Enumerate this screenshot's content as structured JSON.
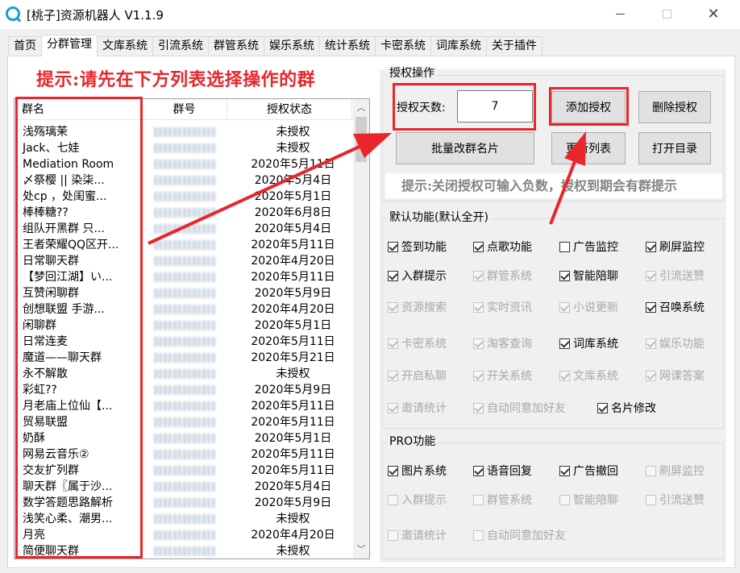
{
  "window": {
    "title": "[桃子]资源机器人 V1.1.9",
    "minimize_label": "—",
    "close_label": "✕"
  },
  "tabs": [
    "首页",
    "分群管理",
    "文库系统",
    "引流系统",
    "群管系统",
    "娱乐系统",
    "统计系统",
    "卡密系统",
    "词库系统",
    "关于插件"
  ],
  "active_tab": "分群管理",
  "notice_top": "提示:请先在下方列表选择操作的群",
  "table": {
    "headers": [
      "群名",
      "群号",
      "授权状态"
    ],
    "rows": [
      {
        "name": "浅殇璃茉",
        "status": "未授权"
      },
      {
        "name": "Jack、七娃",
        "status": "未授权"
      },
      {
        "name": "Mediation Room",
        "status": "2020年5月11日"
      },
      {
        "name": "〆祭樱 || 染柒...",
        "status": "2020年5月4日"
      },
      {
        "name": "处cp ，处闺蜜...",
        "status": "2020年5月1日"
      },
      {
        "name": "棒棒糖??",
        "status": "2020年6月8日"
      },
      {
        "name": "组队开黑群 只...",
        "status": "2020年5月4日"
      },
      {
        "name": "王者荣耀QQ区开...",
        "status": "2020年5月11日"
      },
      {
        "name": "日常聊天群",
        "status": "2020年4月20日"
      },
      {
        "name": "【梦回江湖】い...",
        "status": "2020年5月11日"
      },
      {
        "name": "互赞闲聊群",
        "status": "2020年5月9日"
      },
      {
        "name": "创想联盟 手游...",
        "status": "2020年4月20日"
      },
      {
        "name": "闲聊群",
        "status": "2020年5月1日"
      },
      {
        "name": "日常连麦",
        "status": "2020年5月11日"
      },
      {
        "name": "魔道——聊天群",
        "status": "2020年5月21日"
      },
      {
        "name": "永不解散",
        "status": "未授权"
      },
      {
        "name": "彩虹??",
        "status": "2020年5月9日"
      },
      {
        "name": "月老庙上位仙【...",
        "status": "2020年5月11日"
      },
      {
        "name": "贸易联盟",
        "status": "2020年5月11日"
      },
      {
        "name": "奶酥",
        "status": "2020年5月1日"
      },
      {
        "name": "网易云音乐②",
        "status": "2020年5月11日"
      },
      {
        "name": "交友扩列群",
        "status": "2020年5月11日"
      },
      {
        "name": "聊天群〖属于沙...",
        "status": "2020年5月4日"
      },
      {
        "name": "数学答题思路解析",
        "status": "2020年5月9日"
      },
      {
        "name": "浅笑心柔、潮男...",
        "status": "未授权"
      },
      {
        "name": "月亮",
        "status": "2020年4月20日"
      },
      {
        "name": "简便聊天群",
        "status": "未授权"
      }
    ]
  },
  "auth": {
    "legend": "授权操作",
    "days_label": "授权天数:",
    "days_value": "7",
    "add_button": "添加授权",
    "delete_button": "删除授权",
    "batch_rename_button": "批量改群名片",
    "refresh_button": "更新列表",
    "open_dir_button": "打开目录"
  },
  "notice_mid": "提示:关闭授权可输入负数，授权到期会有群提示",
  "default_features": {
    "legend": "默认功能(默认全开)",
    "items": [
      {
        "label": "签到功能",
        "checked": true,
        "enabled": true
      },
      {
        "label": "点歌功能",
        "checked": true,
        "enabled": true
      },
      {
        "label": "广告监控",
        "checked": false,
        "enabled": true
      },
      {
        "label": "刷屏监控",
        "checked": true,
        "enabled": true
      },
      {
        "label": "入群提示",
        "checked": true,
        "enabled": true
      },
      {
        "label": "群管系统",
        "checked": true,
        "enabled": false
      },
      {
        "label": "智能陪聊",
        "checked": true,
        "enabled": true
      },
      {
        "label": "引流送赞",
        "checked": true,
        "enabled": false
      },
      {
        "label": "资源搜索",
        "checked": true,
        "enabled": false
      },
      {
        "label": "实时资讯",
        "checked": true,
        "enabled": false
      },
      {
        "label": "小说更新",
        "checked": true,
        "enabled": false
      },
      {
        "label": "召唤系统",
        "checked": true,
        "enabled": true
      },
      {
        "label": "卡密系统",
        "checked": true,
        "enabled": false
      },
      {
        "label": "淘客查询",
        "checked": true,
        "enabled": false
      },
      {
        "label": "词库系统",
        "checked": true,
        "enabled": true
      },
      {
        "label": "娱乐功能",
        "checked": true,
        "enabled": false
      },
      {
        "label": "开启私聊",
        "checked": true,
        "enabled": false
      },
      {
        "label": "开关系统",
        "checked": true,
        "enabled": false
      },
      {
        "label": "文库系统",
        "checked": true,
        "enabled": false
      },
      {
        "label": "网课答案",
        "checked": true,
        "enabled": false
      },
      {
        "label": "邀请统计",
        "checked": true,
        "enabled": false
      },
      {
        "label": "自动同意加好友",
        "checked": true,
        "enabled": false
      },
      {
        "label": "名片修改",
        "checked": true,
        "enabled": true
      }
    ]
  },
  "pro_features": {
    "legend": "PRO功能",
    "items": [
      {
        "label": "图片系统",
        "checked": true,
        "enabled": true
      },
      {
        "label": "语音回复",
        "checked": true,
        "enabled": true
      },
      {
        "label": "广告撤回",
        "checked": true,
        "enabled": true
      },
      {
        "label": "刷屏监控",
        "checked": false,
        "enabled": false
      },
      {
        "label": "入群提示",
        "checked": false,
        "enabled": false
      },
      {
        "label": "群管系统",
        "checked": false,
        "enabled": false
      },
      {
        "label": "智能陪聊",
        "checked": false,
        "enabled": false
      },
      {
        "label": "引流送赞",
        "checked": false,
        "enabled": false
      },
      {
        "label": "邀请统计",
        "checked": false,
        "enabled": false
      },
      {
        "label": "自动同意加好友",
        "checked": false,
        "enabled": false
      }
    ]
  },
  "colors": {
    "annotation_red": "#e8262b",
    "app_icon": "#1d9bd8",
    "hint_gray": "#848484"
  }
}
